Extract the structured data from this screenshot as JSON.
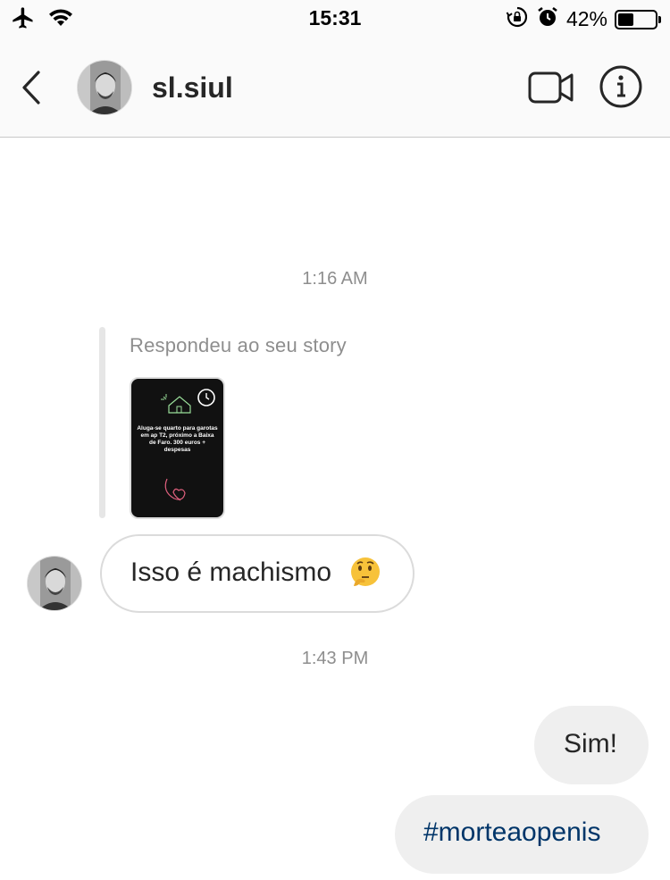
{
  "status_bar": {
    "time": "15:31",
    "battery_percent_label": "42%",
    "battery_level": 0.42
  },
  "header": {
    "username": "sl.siul",
    "icons": [
      "chevron-left-icon",
      "video-camera-icon",
      "info-icon"
    ]
  },
  "conversation": {
    "timestamp_1": "1:16 AM",
    "story_reply_label": "Respondeu ao seu story",
    "story_thumbnail_text": "Aluga-se quarto para garotas em ap T2, próximo a Baixa de Faro. 300 euros + despesas",
    "incoming_message": "Isso é machismo",
    "incoming_emoji": "thinking-face-emoji",
    "timestamp_2": "1:43 PM",
    "outgoing_message_1": "Sim!",
    "outgoing_message_2": "#morteaopenis"
  },
  "colors": {
    "hashtag": "#003569",
    "outgoing_bubble": "#efefef",
    "muted_text": "#8e8e8e"
  }
}
